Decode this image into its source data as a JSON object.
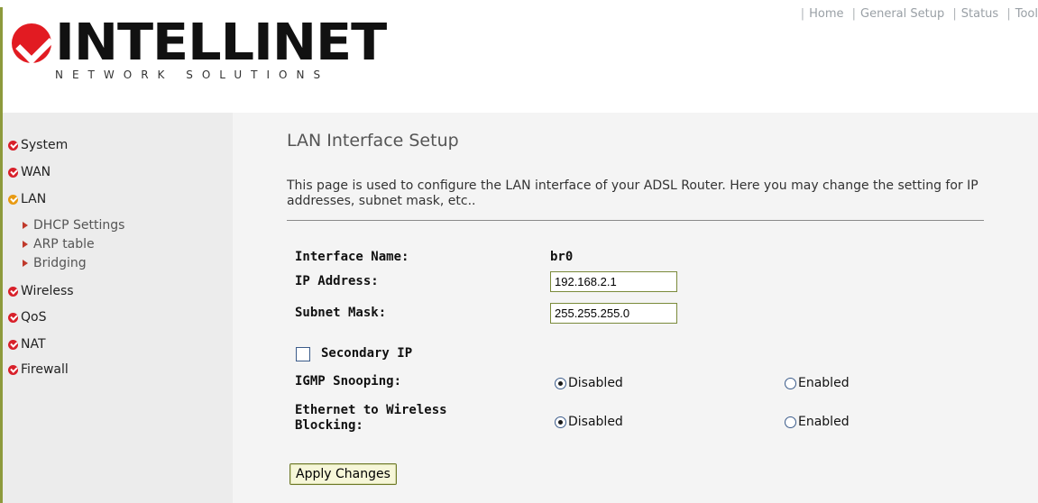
{
  "brand": {
    "name": "INTELLINET",
    "tagline": "NETWORK SOLUTIONS",
    "logo_color": "#e21b22"
  },
  "topnav": {
    "items": [
      "Home",
      "General Setup",
      "Status",
      "Tool"
    ]
  },
  "sidebar": {
    "items": [
      {
        "label": "System",
        "active": false
      },
      {
        "label": "WAN",
        "active": false
      },
      {
        "label": "LAN",
        "active": true
      },
      {
        "label": "Wireless",
        "active": false
      },
      {
        "label": "QoS",
        "active": false
      },
      {
        "label": "NAT",
        "active": false
      },
      {
        "label": "Firewall",
        "active": false
      }
    ],
    "lan_subitems": [
      "DHCP Settings",
      "ARP table",
      "Bridging"
    ]
  },
  "main": {
    "title": "LAN Interface Setup",
    "description": "This page is used to configure the LAN interface of your ADSL Router. Here you may change the setting for IP addresses, subnet mask, etc..",
    "interface_name_label": "Interface Name:",
    "interface_name_value": "br0",
    "ip_label": "IP Address:",
    "ip_value": "192.168.2.1",
    "mask_label": "Subnet Mask:",
    "mask_value": "255.255.255.0",
    "secondary_ip_label": "Secondary IP",
    "secondary_ip_checked": false,
    "igmp_label": "IGMP Snooping:",
    "igmp_selected": "Disabled",
    "eth_wireless_label": "Ethernet to Wireless Blocking:",
    "eth_wireless_selected": "Disabled",
    "opt_disabled": "Disabled",
    "opt_enabled": "Enabled",
    "apply_button": "Apply Changes"
  },
  "colors": {
    "accent_rule": "#8d9a3c",
    "sidebar_bg": "#ececec",
    "main_bg": "#f4f4f4",
    "bullet": "#d8202a",
    "bullet_active": "#e89a12"
  }
}
